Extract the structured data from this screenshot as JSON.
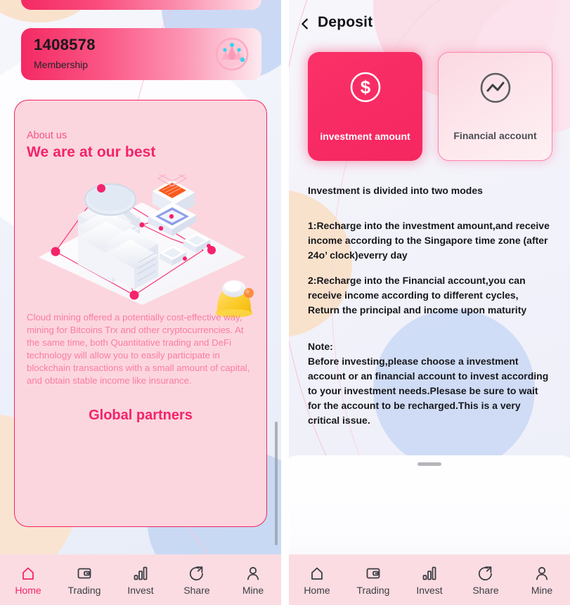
{
  "left_panel": {
    "membership_card": {
      "number": "1408578",
      "label": "Membership",
      "badge_icon": "membership-badge-icon"
    },
    "about_card": {
      "kicker": "About us",
      "title": "We are at our best",
      "illustration_icon": "cloud-mining-isometric-illustration",
      "bell_icon": "bell-3d-icon",
      "body": "Cloud mining offered a potentially cost-effective way, mining for Bitcoins Trx and other cryptocurrencies. At the same time, both Quantitative trading and DeFi technology will allow you to easily participate in blockchain transactions with a small amount of capital, and obtain stable income like insurance.",
      "partners_title": "Global partners"
    },
    "bottom_nav": {
      "active_index": 0,
      "items": [
        {
          "label": "Home",
          "icon": "home-icon"
        },
        {
          "label": "Trading",
          "icon": "wallet-icon"
        },
        {
          "label": "Invest",
          "icon": "bar-chart-icon"
        },
        {
          "label": "Share",
          "icon": "share-icon"
        },
        {
          "label": "Mine",
          "icon": "user-icon"
        }
      ]
    }
  },
  "right_panel": {
    "header": {
      "back_icon": "chevron-left-icon",
      "title": "Deposit"
    },
    "modes": [
      {
        "label": "investment amount",
        "icon": "dollar-circle-icon",
        "selected": true
      },
      {
        "label": "Financial account",
        "icon": "trend-line-circle-icon",
        "selected": false
      }
    ],
    "content": {
      "heading": "Investment is divided into two modes",
      "paragraph_1": "1:Recharge into the investment amount,and receive income according to the Singapore time zone (after 24o’ clock)everry day",
      "paragraph_2": "2:Recharge into the Financial account,you can receive income according to different cycles, Return the principal and income upon maturity",
      "note_title": "Note:",
      "note_body": "Before investing,please choose a investment account or an financial account to invest according to your investment needs.Plesase be sure to wait for the account to be recharged.This is a very critical issue."
    },
    "sheet": {
      "handle_icon": "drag-handle-icon"
    },
    "bottom_nav": {
      "active_index": -1,
      "items": [
        {
          "label": "Home",
          "icon": "home-icon"
        },
        {
          "label": "Trading",
          "icon": "wallet-icon"
        },
        {
          "label": "Invest",
          "icon": "bar-chart-icon"
        },
        {
          "label": "Share",
          "icon": "share-icon"
        },
        {
          "label": "Mine",
          "icon": "user-icon"
        }
      ]
    }
  },
  "colors": {
    "accent_pink": "#f4236b",
    "accent_pink_deep": "#f72a63",
    "card_pink_fill": "#fcd6de",
    "nav_bar": "#fbdce3",
    "body_text": "#17181c",
    "muted_pink_text": "#fa7ca3"
  }
}
